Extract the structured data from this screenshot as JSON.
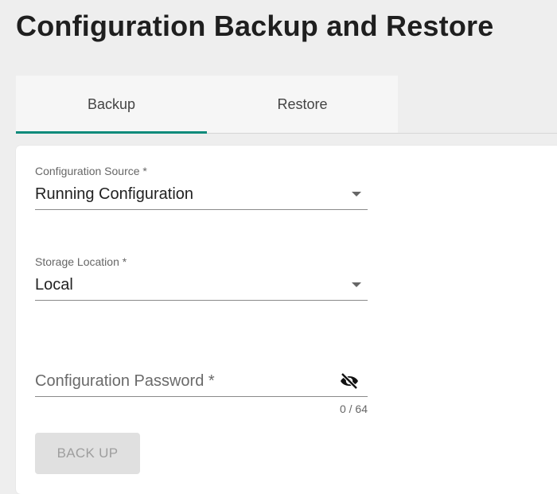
{
  "page": {
    "title": "Configuration Backup and Restore"
  },
  "tabs": [
    {
      "label": "Backup",
      "active": true
    },
    {
      "label": "Restore",
      "active": false
    }
  ],
  "form": {
    "config_source": {
      "label": "Configuration Source *",
      "value": "Running Configuration"
    },
    "storage_location": {
      "label": "Storage Location *",
      "value": "Local"
    },
    "password": {
      "placeholder": "Configuration Password *",
      "counter": "0 / 64",
      "visibility_icon": "eye-off-icon"
    }
  },
  "actions": {
    "backup_label": "BACK UP",
    "backup_disabled": true
  },
  "colors": {
    "accent": "#0a8a7a",
    "background": "#eeeeee",
    "card": "#ffffff"
  }
}
